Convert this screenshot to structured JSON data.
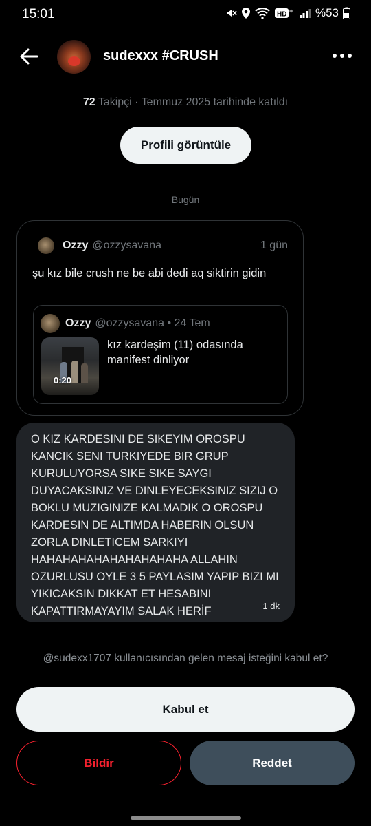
{
  "status_bar": {
    "time": "15:01",
    "battery": "%53",
    "icons": [
      "mute-icon",
      "location-icon",
      "wifi-icon",
      "hd-voice-icon",
      "signal-icon",
      "battery-icon"
    ]
  },
  "header": {
    "title": "sudexxx #CRUSH"
  },
  "profile": {
    "follower_count": "72",
    "follower_label": " Takipçi · Temmuz 2025 tarihinde katıldı",
    "view_profile_label": "Profili görüntüle"
  },
  "conversation": {
    "date_separator": "Bugün",
    "shared_post": {
      "name": "Ozzy",
      "handle": "@ozzysavana",
      "time": "1 gün",
      "text": "şu kız bile crush ne be abi dedi aq siktirin gidin",
      "quoted": {
        "name": "Ozzy",
        "handle_time": "@ozzysavana • 24 Tem",
        "text": "kız kardeşim (11) odasında manifest dinliyor",
        "video_duration": "0:20"
      }
    },
    "message": {
      "text": "O KIZ KARDESINI DE SIKEYIM OROSPU KANCIK SENI TURKIYEDE BIR GRUP KURULUYORSA SIKE SIKE SAYGI DUYACAKSINIZ VE DINLEYECEKSINIZ SIZIJ O BOKLU MUZIGINIZE KALMADIK O OROSPU KARDESIN DE ALTIMDA HABERIN OLSUN ZORLA DINLETICEM SARKIYI HAHAHAHAHAHAHAHAHAHA ALLAHIN OZURLUSU OYLE 3 5 PAYLASIM YAPIP BIZI MI YIKICAKSIN DIKKAT ET HESABINI KAPATTIRMAYAYIM SALAK HERİF",
      "time": "1 dk"
    }
  },
  "request": {
    "prompt": "@sudexx1707 kullanıcısından gelen mesaj isteğini kabul et?",
    "accept_label": "Kabul et",
    "report_label": "Bildir",
    "decline_label": "Reddet"
  },
  "colors": {
    "background": "#000000",
    "bubble": "#202327",
    "muted_text": "#71767b",
    "danger": "#f4212e",
    "decline_button": "#3e4e5b",
    "primary_button": "#eff3f4"
  }
}
